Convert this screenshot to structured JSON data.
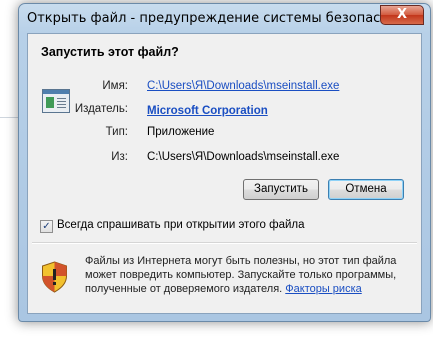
{
  "window": {
    "title": "Открыть файл - предупреждение системы безопасности",
    "close_label": "X"
  },
  "dialog": {
    "headline": "Запустить этот файл?",
    "fields": {
      "name_label": "Имя:",
      "name_value": "C:\\Users\\Я\\Downloads\\mseinstall.exe",
      "publisher_label": "Издатель:",
      "publisher_value": "Microsoft Corporation",
      "type_label": "Тип:",
      "type_value": "Приложение",
      "from_label": "Из:",
      "from_value": "C:\\Users\\Я\\Downloads\\mseinstall.exe"
    },
    "buttons": {
      "run_label": "Запустить",
      "cancel_label": "Отмена"
    },
    "checkbox": {
      "label": "Всегда спрашивать при открытии этого файла",
      "checked": true
    },
    "warning": {
      "text": "Файлы из Интернета могут быть полезны, но этот тип файла может повредить компьютер. Запускайте только программы, полученные от доверяемого издателя.",
      "link_label": "Факторы риска"
    }
  },
  "colors": {
    "link": "#1a4ec2",
    "close_button": "#c2361b",
    "shield_yellow": "#f2c12e",
    "shield_red": "#d2532b"
  }
}
